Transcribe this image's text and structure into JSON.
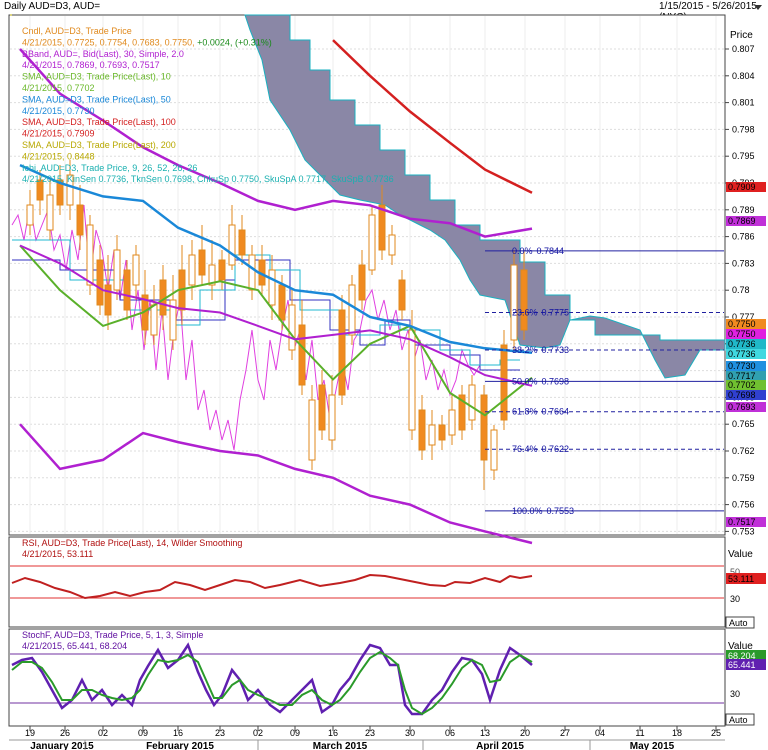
{
  "header": {
    "title": "Daily AUD=D3, AUD=",
    "range": "1/15/2015 - 5/26/2015 (NYC)",
    "icon": "dropdown-arrow-icon"
  },
  "price_panel": {
    "axis_title": "Price",
    "ticks": [
      "0.807",
      "0.804",
      "0.801",
      "0.798",
      "0.795",
      "0.792",
      "0.789",
      "0.786",
      "0.783",
      "0.78",
      "0.777",
      "0.774",
      "0.771",
      "0.768",
      "0.765",
      "0.762",
      "0.759",
      "0.756",
      "0.753"
    ],
    "legend": [
      {
        "text": "Cndl, AUD=D3, Trade Price",
        "color": "#e08a1e"
      },
      {
        "text": "4/21/2015, 0.7725, 0.7754, 0.7683, 0.7750, +0.0024, (+0.31%)",
        "color": "#e08a1e",
        "extra": "+0.0024, (+0.31%)",
        "extra_color": "#1a8a1a"
      },
      {
        "text": "BBand, AUD=, Bid(Last), 30, Simple, 2.0",
        "color": "#b020d0"
      },
      {
        "text": "4/21/2015, 0.7869, 0.7693, 0.7517",
        "color": "#b020d0"
      },
      {
        "text": "SMA, AUD=D3, Trade Price(Last), 10",
        "color": "#6ab82a"
      },
      {
        "text": "4/21/2015, 0.7702",
        "color": "#6ab82a"
      },
      {
        "text": "SMA, AUD=D3, Trade Price(Last), 50",
        "color": "#1a88d8"
      },
      {
        "text": "4/21/2015, 0.7730",
        "color": "#1a88d8"
      },
      {
        "text": "SMA, AUD=D3, Trade Price(Last), 100",
        "color": "#d42020"
      },
      {
        "text": "4/21/2015, 0.7909",
        "color": "#d42020"
      },
      {
        "text": "SMA, AUD=D3, Trade Price(Last), 200",
        "color": "#b8a800"
      },
      {
        "text": "4/21/2015, 0.8448",
        "color": "#b8a800"
      },
      {
        "text": "Ichi, AUD=D3, Trade Price, 9, 26, 52, 26, 26",
        "color": "#1ab0b0"
      },
      {
        "text": "4/21/2015, KinSen 0.7736, TknSen 0.7698, ChkuSp 0.7750, SkuSpA 0.7717, SkuSpB 0.7736",
        "color": "#1ab0b0"
      }
    ],
    "value_tags": [
      {
        "text": "0.7909",
        "bg": "#e02020",
        "fg": "#000"
      },
      {
        "text": "0.7869",
        "bg": "#c030d8",
        "fg": "#000"
      },
      {
        "text": "0.7750",
        "bg": "#f08a20",
        "fg": "#000"
      },
      {
        "text": "0.7750",
        "bg": "#e020e0",
        "fg": "#000"
      },
      {
        "text": "0.7736",
        "bg": "#20b8c8",
        "fg": "#000"
      },
      {
        "text": "0.7736",
        "bg": "#40d8e0",
        "fg": "#000"
      },
      {
        "text": "0.7730",
        "bg": "#2090e0",
        "fg": "#000"
      },
      {
        "text": "0.7717",
        "bg": "#30a0b0",
        "fg": "#000"
      },
      {
        "text": "0.7702",
        "bg": "#70c030",
        "fg": "#000"
      },
      {
        "text": "0.7698",
        "bg": "#3040d0",
        "fg": "#000"
      },
      {
        "text": "0.7693",
        "bg": "#c030d8",
        "fg": "#000"
      },
      {
        "text": "0.7517",
        "bg": "#c030d8",
        "fg": "#000"
      }
    ],
    "fib_levels": [
      {
        "label": "0.0%",
        "value": "0.7844"
      },
      {
        "label": "23.6%",
        "value": "0.7775"
      },
      {
        "label": "38.2%",
        "value": "0.7733"
      },
      {
        "label": "50.0%",
        "value": "0.7698"
      },
      {
        "label": "61.8%",
        "value": "0.7664"
      },
      {
        "label": "76.4%",
        "value": "0.7622"
      },
      {
        "label": "100.0%",
        "value": "0.7553"
      }
    ]
  },
  "rsi_panel": {
    "legend1": "RSI, AUD=D3, Trade Price(Last), 14, Wilder Smoothing",
    "legend2": "4/21/2015, 53.111",
    "axis_title": "Value",
    "tick": "30",
    "partial_tick": "50",
    "tag": "53.111",
    "auto": "Auto"
  },
  "stoch_panel": {
    "legend1": "StochF, AUD=D3, Trade Price, 5, 1, 3, Simple",
    "legend2": "4/21/2015, 65.441, 68.204",
    "axis_title": "Value",
    "tick": "30",
    "tag1": "68.204",
    "tag2": "65.441",
    "auto": "Auto"
  },
  "x_axis": {
    "day_labels": [
      "19",
      "26",
      "02",
      "09",
      "16",
      "23",
      "02",
      "09",
      "16",
      "23",
      "30",
      "06",
      "13",
      "20",
      "27",
      "04",
      "11",
      "18",
      "25"
    ],
    "month_labels": [
      "January 2015",
      "February 2015",
      "March 2015",
      "April 2015",
      "May 2015"
    ]
  },
  "chart_data": {
    "type": "line",
    "title": "Daily AUD=D3, AUD=",
    "xlabel": "",
    "ylabel": "Price",
    "ylim": [
      0.751,
      0.809
    ],
    "x": [
      "2015-01-19",
      "2015-01-26",
      "2015-02-02",
      "2015-02-09",
      "2015-02-16",
      "2015-02-23",
      "2015-03-02",
      "2015-03-09",
      "2015-03-16",
      "2015-03-23",
      "2015-03-30",
      "2015-04-06",
      "2015-04-13",
      "2015-04-20"
    ],
    "series": [
      {
        "name": "SMA 10",
        "values": [
          0.785,
          0.78,
          0.776,
          0.7775,
          0.78,
          0.781,
          0.78,
          0.7745,
          0.77,
          0.774,
          0.776,
          0.7685,
          0.766,
          0.7702
        ]
      },
      {
        "name": "SMA 50",
        "values": [
          0.794,
          0.792,
          0.7905,
          0.79,
          0.787,
          0.785,
          0.782,
          0.78,
          0.7795,
          0.777,
          0.776,
          0.7742,
          0.7735,
          0.773
        ]
      },
      {
        "name": "SMA 100",
        "values": [
          null,
          null,
          null,
          null,
          null,
          null,
          null,
          null,
          0.808,
          0.804,
          0.8,
          0.7965,
          0.7935,
          0.7909
        ]
      },
      {
        "name": "BBand upper",
        "values": [
          0.807,
          0.802,
          0.799,
          0.796,
          0.794,
          0.792,
          0.79,
          0.789,
          0.79,
          0.7895,
          0.788,
          0.7875,
          0.786,
          0.7869
        ]
      },
      {
        "name": "BBand middle",
        "values": [
          0.785,
          0.783,
          0.78,
          0.779,
          0.778,
          0.7775,
          0.776,
          0.7745,
          0.775,
          0.7755,
          0.7745,
          0.7725,
          0.7705,
          0.7693
        ]
      },
      {
        "name": "BBand lower",
        "values": [
          0.765,
          0.76,
          0.761,
          0.764,
          0.763,
          0.762,
          0.7615,
          0.76,
          0.759,
          0.757,
          0.756,
          0.754,
          0.753,
          0.7517
        ]
      }
    ],
    "fibonacci": {
      "0.0%": 0.7844,
      "23.6%": 0.7775,
      "38.2%": 0.7733,
      "50.0%": 0.7698,
      "61.8%": 0.7664,
      "76.4%": 0.7622,
      "100.0%": 0.7553
    }
  }
}
